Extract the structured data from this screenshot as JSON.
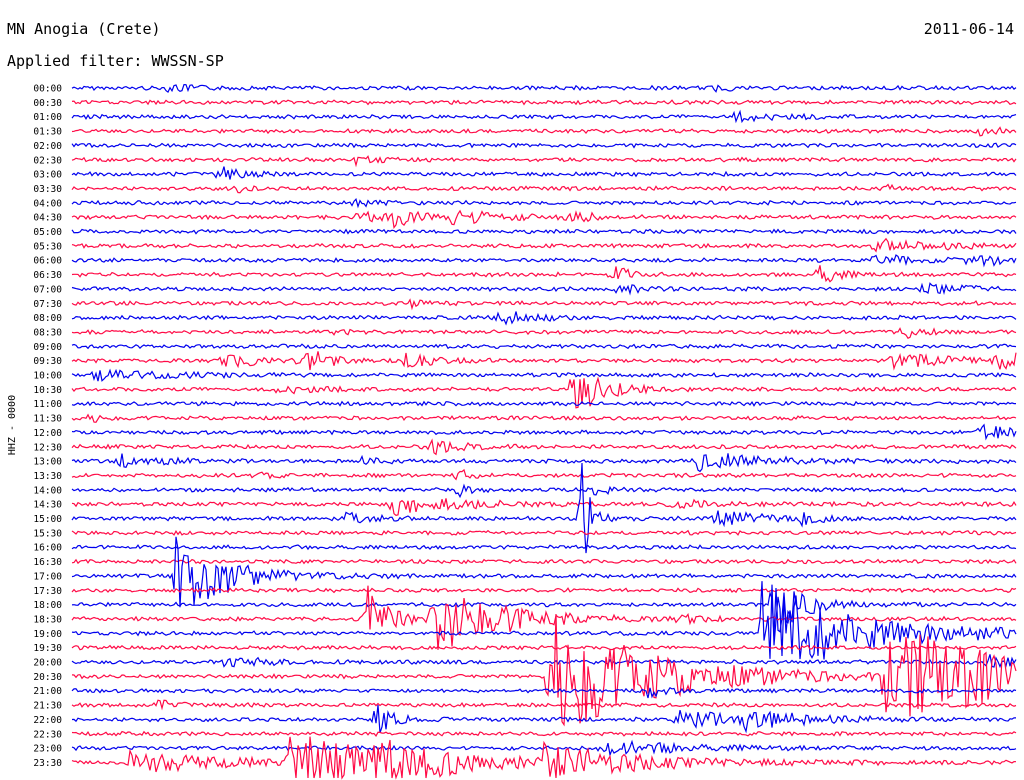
{
  "header": {
    "station": "MN Anogia (Crete)",
    "date": "2011-06-14",
    "filter": "Applied filter: WWSSN-SP"
  },
  "colors": {
    "blue": "#0000ee",
    "red": "#ff0a46"
  },
  "chart_data": {
    "type": "line",
    "title": "MN Anogia (Crete)",
    "ylabel": "HHZ - 0000",
    "tick_labels": [
      "00:00",
      "00:30",
      "01:00",
      "01:30",
      "02:00",
      "02:30",
      "03:00",
      "03:30",
      "04:00",
      "04:30",
      "05:00",
      "05:30",
      "06:00",
      "06:30",
      "07:00",
      "07:30",
      "08:00",
      "08:30",
      "09:00",
      "09:30",
      "10:00",
      "10:30",
      "11:00",
      "11:30",
      "12:00",
      "12:30",
      "13:00",
      "13:30",
      "14:00",
      "14:30",
      "15:00",
      "15:30",
      "16:00",
      "16:30",
      "17:00",
      "17:30",
      "18:00",
      "18:30",
      "19:00",
      "19:30",
      "20:00",
      "20:30",
      "21:00",
      "21:30",
      "22:00",
      "22:30",
      "23:00",
      "23:30"
    ],
    "trace_colors": "alternating blue / red",
    "events": [
      {
        "row": 0,
        "pos": 0.1,
        "amp": 4,
        "dur": 0.03
      },
      {
        "row": 0,
        "pos": 0.68,
        "amp": 3,
        "dur": 0.02
      },
      {
        "row": 2,
        "pos": 0.7,
        "amp": 5,
        "dur": 0.04
      },
      {
        "row": 3,
        "pos": 0.96,
        "amp": 4,
        "dur": 0.03
      },
      {
        "row": 5,
        "pos": 0.3,
        "amp": 4,
        "dur": 0.03
      },
      {
        "row": 6,
        "pos": 0.155,
        "amp": 9,
        "dur": 0.02
      },
      {
        "row": 7,
        "pos": 0.175,
        "amp": 5,
        "dur": 0.01
      },
      {
        "row": 7,
        "pos": 0.86,
        "amp": 5,
        "dur": 0.01
      },
      {
        "row": 8,
        "pos": 0.3,
        "amp": 3,
        "dur": 0.02
      },
      {
        "row": 9,
        "pos": 0.3,
        "amp": 4,
        "dur": 0.06
      },
      {
        "row": 9,
        "pos": 0.34,
        "amp": 8,
        "dur": 0.02
      },
      {
        "row": 9,
        "pos": 0.4,
        "amp": 7,
        "dur": 0.05
      },
      {
        "row": 9,
        "pos": 0.525,
        "amp": 12,
        "dur": 0.015
      },
      {
        "row": 11,
        "pos": 0.85,
        "amp": 7,
        "dur": 0.06
      },
      {
        "row": 12,
        "pos": 0.85,
        "amp": 8,
        "dur": 0.03
      },
      {
        "row": 12,
        "pos": 0.95,
        "amp": 6,
        "dur": 0.05
      },
      {
        "row": 13,
        "pos": 0.57,
        "amp": 9,
        "dur": 0.02
      },
      {
        "row": 13,
        "pos": 0.79,
        "amp": 12,
        "dur": 0.02
      },
      {
        "row": 14,
        "pos": 0.58,
        "amp": 6,
        "dur": 0.02
      },
      {
        "row": 14,
        "pos": 0.9,
        "amp": 6,
        "dur": 0.04
      },
      {
        "row": 15,
        "pos": 0.36,
        "amp": 6,
        "dur": 0.01
      },
      {
        "row": 16,
        "pos": 0.45,
        "amp": 7,
        "dur": 0.04
      },
      {
        "row": 17,
        "pos": 0.28,
        "amp": 5,
        "dur": 0.01
      },
      {
        "row": 17,
        "pos": 0.88,
        "amp": 6,
        "dur": 0.02
      },
      {
        "row": 19,
        "pos": 0.16,
        "amp": 6,
        "dur": 0.05
      },
      {
        "row": 19,
        "pos": 0.25,
        "amp": 16,
        "dur": 0.015
      },
      {
        "row": 19,
        "pos": 0.35,
        "amp": 7,
        "dur": 0.03
      },
      {
        "row": 19,
        "pos": 0.86,
        "amp": 9,
        "dur": 0.06
      },
      {
        "row": 19,
        "pos": 0.98,
        "amp": 9,
        "dur": 0.04
      },
      {
        "row": 20,
        "pos": 0.02,
        "amp": 5,
        "dur": 0.08
      },
      {
        "row": 21,
        "pos": 0.22,
        "amp": 4,
        "dur": 0.04
      },
      {
        "row": 21,
        "pos": 0.53,
        "amp": 30,
        "dur": 0.03
      },
      {
        "row": 23,
        "pos": 0.02,
        "amp": 6,
        "dur": 0.01
      },
      {
        "row": 24,
        "pos": 0.96,
        "amp": 9,
        "dur": 0.03
      },
      {
        "row": 25,
        "pos": 0.38,
        "amp": 7,
        "dur": 0.03
      },
      {
        "row": 26,
        "pos": 0.05,
        "amp": 7,
        "dur": 0.04
      },
      {
        "row": 26,
        "pos": 0.3,
        "amp": 4,
        "dur": 0.02
      },
      {
        "row": 26,
        "pos": 0.66,
        "amp": 11,
        "dur": 0.06
      },
      {
        "row": 27,
        "pos": 0.2,
        "amp": 6,
        "dur": 0.01
      },
      {
        "row": 27,
        "pos": 0.41,
        "amp": 6,
        "dur": 0.01
      },
      {
        "row": 28,
        "pos": 0.41,
        "amp": 7,
        "dur": 0.01
      },
      {
        "row": 28,
        "pos": 0.55,
        "amp": 5,
        "dur": 0.02
      },
      {
        "row": 29,
        "pos": 0.34,
        "amp": 10,
        "dur": 0.06
      },
      {
        "row": 29,
        "pos": 0.63,
        "amp": 5,
        "dur": 0.04
      },
      {
        "row": 30,
        "pos": 0.29,
        "amp": 6,
        "dur": 0.03
      },
      {
        "row": 30,
        "pos": 0.68,
        "amp": 7,
        "dur": 0.06
      },
      {
        "row": 30,
        "pos": 0.77,
        "amp": 5,
        "dur": 0.02
      },
      {
        "row": 30,
        "pos": 0.54,
        "amp": 60,
        "dur": 0.01
      },
      {
        "row": 34,
        "pos": 0.11,
        "amp": 45,
        "dur": 0.05
      },
      {
        "row": 36,
        "pos": 0.74,
        "amp": 35,
        "dur": 0.03
      },
      {
        "row": 37,
        "pos": 0.31,
        "amp": 40,
        "dur": 0.02
      },
      {
        "row": 37,
        "pos": 0.38,
        "amp": 45,
        "dur": 0.06
      },
      {
        "row": 37,
        "pos": 0.64,
        "amp": 5,
        "dur": 0.02
      },
      {
        "row": 38,
        "pos": 0.73,
        "amp": 55,
        "dur": 0.09
      },
      {
        "row": 38,
        "pos": 0.95,
        "amp": 5,
        "dur": 0.02
      },
      {
        "row": 40,
        "pos": 0.16,
        "amp": 6,
        "dur": 0.04
      },
      {
        "row": 40,
        "pos": 0.97,
        "amp": 8,
        "dur": 0.03
      },
      {
        "row": 41,
        "pos": 0.86,
        "amp": 60,
        "dur": 0.12
      },
      {
        "row": 42,
        "pos": 0.61,
        "amp": 6,
        "dur": 0.02
      },
      {
        "row": 43,
        "pos": 0.09,
        "amp": 5,
        "dur": 0.02
      },
      {
        "row": 44,
        "pos": 0.32,
        "amp": 22,
        "dur": 0.015
      },
      {
        "row": 44,
        "pos": 0.64,
        "amp": 12,
        "dur": 0.05
      },
      {
        "row": 44,
        "pos": 0.71,
        "amp": 10,
        "dur": 0.06
      },
      {
        "row": 41,
        "pos": 0.505,
        "amp": 70,
        "dur": 0.1
      },
      {
        "row": 46,
        "pos": 0.56,
        "amp": 8,
        "dur": 0.08
      },
      {
        "row": 47,
        "pos": 0.06,
        "amp": 10,
        "dur": 0.12
      },
      {
        "row": 47,
        "pos": 0.23,
        "amp": 35,
        "dur": 0.08
      },
      {
        "row": 47,
        "pos": 0.32,
        "amp": 18,
        "dur": 0.08
      },
      {
        "row": 47,
        "pos": 0.5,
        "amp": 15,
        "dur": 0.1
      }
    ]
  }
}
